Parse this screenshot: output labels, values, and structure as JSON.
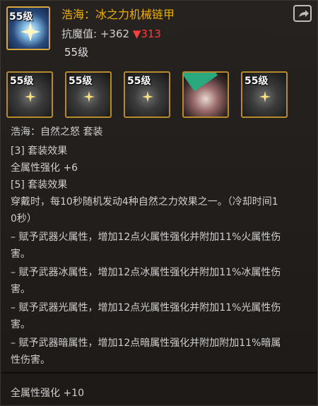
{
  "header": {
    "main_level": "55级",
    "title": "浩海：冰之力机械链甲",
    "attr_label": "抗魔值: ",
    "attr_value": "+362",
    "attr_change": "▼313",
    "level_text": "55级"
  },
  "slots": [
    {
      "level": "55级"
    },
    {
      "level": "55级"
    },
    {
      "level": "55级"
    },
    {
      "level": ""
    },
    {
      "level": "55级"
    }
  ],
  "set": {
    "name": "浩海：自然之怒 套装",
    "tier3_header": "[3] 套装效果",
    "tier3_effect": "全属性强化 +6",
    "tier5_header": "[5] 套装效果",
    "tier5_line1": "穿戴时，每10秒随机发动4种自然之力效果之一。（冷却时间1",
    "tier5_line2": "0秒）",
    "fire1": "– 赋予武器火属性，增加12点火属性强化并附加11%火属性伤",
    "fire2": "害。",
    "ice1": "– 赋予武器冰属性，增加12点冰属性强化并附加11%冰属性伤",
    "ice2": "害。",
    "light1": "– 赋予武器光属性，增加12点光属性强化并附加11%光属性伤",
    "light2": "害。",
    "dark1": "– 赋予武器暗属性，增加12点暗属性强化并附加附加11%暗属",
    "dark2": "性伤害。",
    "bottom": "全属性强化 +10"
  },
  "colors": {
    "title": "#f0b000",
    "decrease": "#ff3d3d",
    "text": "#cfcfcf"
  },
  "icons": {
    "share": "share-icon",
    "sparkle": "sparkle-icon"
  }
}
